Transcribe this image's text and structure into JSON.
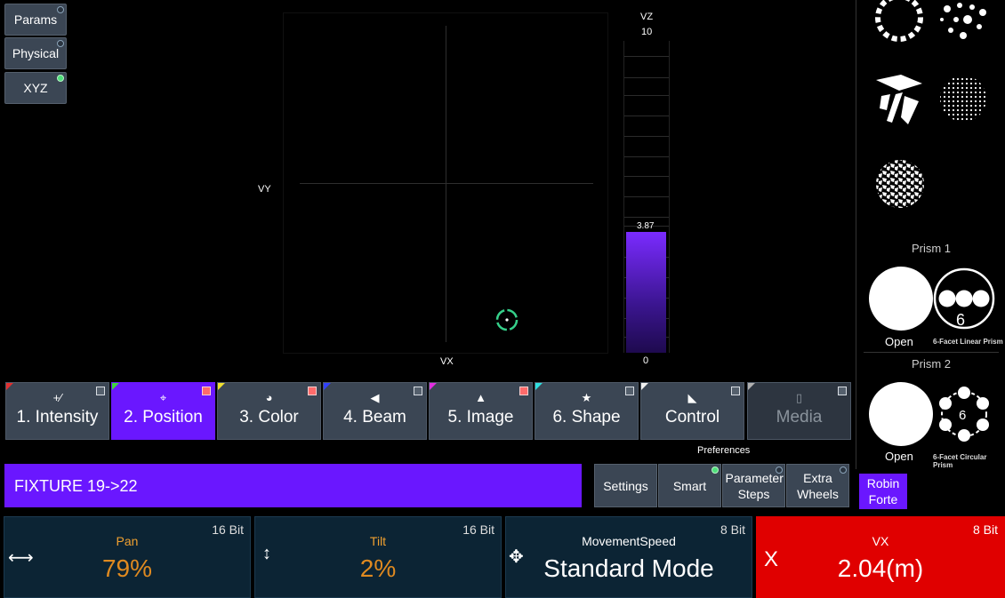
{
  "mode_buttons": [
    {
      "label": "Params",
      "led": "off"
    },
    {
      "label": "Physical",
      "led": "off"
    },
    {
      "label": "XYZ",
      "led": "on"
    }
  ],
  "xy_pad": {
    "x_label": "VX",
    "y_label": "VY"
  },
  "vz_slider": {
    "label": "VZ",
    "max": "10",
    "min": "0",
    "value": "3.87",
    "level": 0.387
  },
  "prisms": [
    {
      "title": "Prism 1",
      "open_label": "Open",
      "prism_label": "6-Facet Linear Prism",
      "facet_count": "6"
    },
    {
      "title": "Prism 2",
      "open_label": "Open",
      "prism_label": "6-Facet Circular Prism",
      "facet_count": "6"
    }
  ],
  "tabs": [
    {
      "label": "1. Intensity",
      "icon": "intensity-icon",
      "corner_color": "#e03030",
      "flag": "gray",
      "state": "normal"
    },
    {
      "label": "2. Position",
      "icon": "position-icon",
      "corner_color": "#3fd13f",
      "flag": "red",
      "state": "active"
    },
    {
      "label": "3. Color",
      "icon": "palette-icon",
      "corner_color": "#f0e030",
      "flag": "red",
      "state": "normal"
    },
    {
      "label": "4. Beam",
      "icon": "beam-icon",
      "corner_color": "#3040ff",
      "flag": "gray",
      "state": "normal"
    },
    {
      "label": "5. Image",
      "icon": "image-icon",
      "corner_color": "#e030e0",
      "flag": "red",
      "state": "normal"
    },
    {
      "label": "6. Shape",
      "icon": "star-icon",
      "corner_color": "#30e0e0",
      "flag": "gray",
      "state": "normal"
    },
    {
      "label": "Control",
      "icon": "control-icon",
      "corner_color": "#f0f0f0",
      "flag": "gray",
      "state": "normal"
    },
    {
      "label": "Media",
      "icon": "media-icon",
      "corner_color": "#b0b0b0",
      "flag": "gray",
      "state": "disabled"
    }
  ],
  "fixture_bar": {
    "text": "FIXTURE 19->22"
  },
  "preferences": {
    "title": "Preferences",
    "buttons": [
      {
        "label": "Settings",
        "led": "none"
      },
      {
        "label": "Smart",
        "led": "on"
      },
      {
        "label": "Parameter Steps",
        "led": "off"
      },
      {
        "label": "Extra Wheels",
        "led": "off"
      }
    ]
  },
  "fixture_type": {
    "label": "Robin Forte"
  },
  "encoders": [
    {
      "name": "Pan",
      "bits": "16 Bit",
      "value": "79%",
      "icon": "pan-arrows-icon"
    },
    {
      "name": "Tilt",
      "bits": "16 Bit",
      "value": "2%",
      "icon": "tilt-arrows-icon"
    },
    {
      "name": "MovementSpeed",
      "bits": "8 Bit",
      "value": "Standard Mode",
      "icon": "move-icon"
    },
    {
      "name": "VX",
      "bits": "8 Bit",
      "value": "2.04(m)",
      "icon": "x-icon",
      "icon_text": "X"
    }
  ],
  "colors": {
    "accent": "#6a17ff",
    "button": "#3b4654",
    "encoder_bg": "#0c2434",
    "encoder_highlight": "#e00000",
    "value_orange": "#e08a20"
  }
}
